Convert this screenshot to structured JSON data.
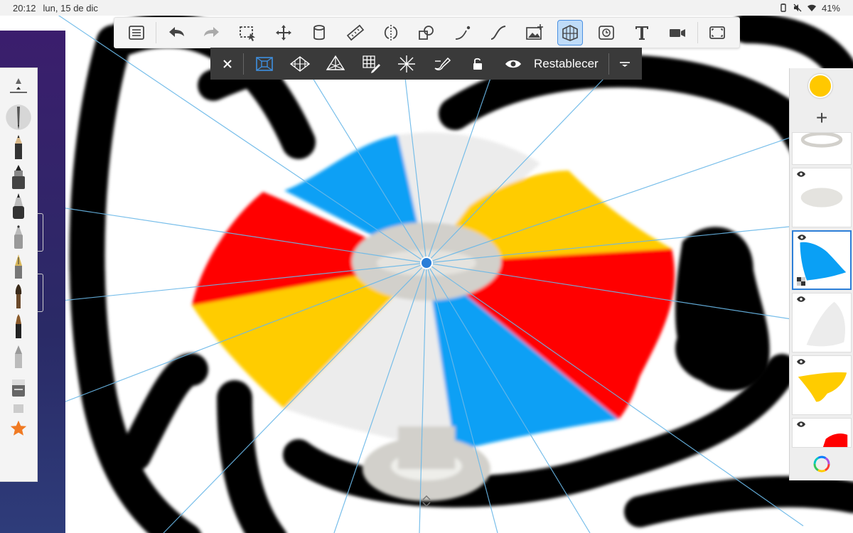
{
  "status_bar": {
    "time": "20:12",
    "date": "lun, 15 de dic",
    "battery": "41%",
    "icons": [
      "battery-saver-icon",
      "mute-icon",
      "wifi-icon"
    ]
  },
  "main_toolbar": {
    "tools": [
      "menu-list-icon",
      "undo-icon",
      "redo-icon",
      "selection-icon",
      "transform-icon",
      "fill-bucket-icon",
      "ruler-icon",
      "symmetry-icon",
      "shape-icon",
      "stroke-curve-icon",
      "curve-icon",
      "add-image-icon",
      "perspective-guide-icon",
      "time-lapse-icon",
      "text-icon",
      "video-icon",
      "fullscreen-icon"
    ],
    "active_tool": "perspective-guide-icon"
  },
  "perspective_bar": {
    "tools": [
      "close-icon",
      "one-point-perspective-icon",
      "two-point-perspective-icon",
      "three-point-perspective-icon",
      "grid-edit-icon",
      "radial-symmetry-icon",
      "snap-brush-icon",
      "lock-icon",
      "visibility-icon"
    ],
    "active_tool": "one-point-perspective-icon",
    "reset_label": "Restablecer"
  },
  "brushes": [
    "brush-settings-icon",
    "ballpoint-pen-icon",
    "pencil-icon",
    "marker-icon",
    "ink-pen-icon",
    "airbrush-icon",
    "fountain-pen-icon",
    "paintbrush-icon",
    "calligraphy-brush-icon",
    "smudge-icon",
    "eraser-icon",
    "eraser-small-icon",
    "favorites-star-icon"
  ],
  "layers": {
    "current_color": "#ffc800",
    "add_label": "+",
    "items": [
      "layer-base-ring",
      "layer-grey-shape",
      "layer-blue-shape",
      "layer-white-shape",
      "layer-yellow-shape",
      "layer-red-shape"
    ],
    "selected": "layer-blue-shape"
  },
  "colors": {
    "red": "#ff0000",
    "yellow": "#ffcc00",
    "blue": "#0aa0f5",
    "white_panel": "#ececec",
    "grey": "#d2d0cb",
    "guide": "#6ab8e8",
    "handle": "#2a7ed8"
  }
}
